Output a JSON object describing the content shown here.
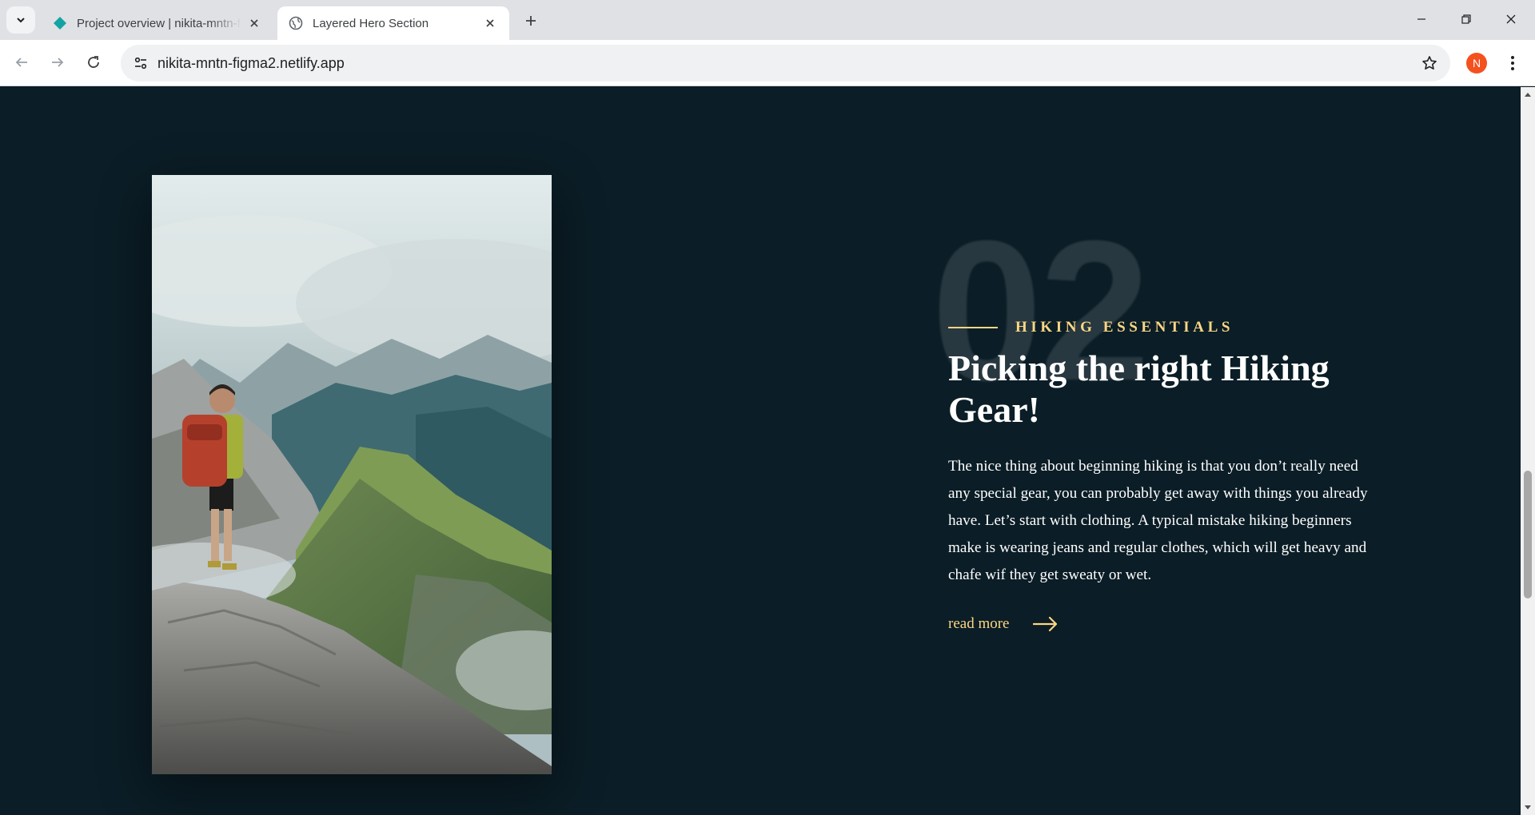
{
  "browser": {
    "tabs": [
      {
        "title": "Project overview | nikita-mntn-f",
        "active": false,
        "favicon": "netlify-diamond-icon"
      },
      {
        "title": "Layered Hero Section",
        "active": true,
        "favicon": "globe-icon"
      }
    ],
    "url": "nikita-mntn-figma2.netlify.app",
    "profile_initial": "N",
    "colors": {
      "tabbar": "#dfe1e5",
      "profile": "#f4511e"
    }
  },
  "hero": {
    "big_number": "02",
    "eyebrow": "HIKING ESSENTIALS",
    "heading": "Picking the right Hiking Gear!",
    "body": "The nice thing about beginning hiking is that you don’t really need any special gear, you can probably get away with things you already have. Let’s start with clothing. A typical mistake hiking beginners make is wearing jeans and regular clothes, which will get heavy and chafe wif they get sweaty or wet.",
    "read_more": "read more",
    "image": "hiker-on-mountain-ridge",
    "colors": {
      "background": "#0b1d26",
      "accent": "#fbd784",
      "text": "#ffffff"
    }
  }
}
